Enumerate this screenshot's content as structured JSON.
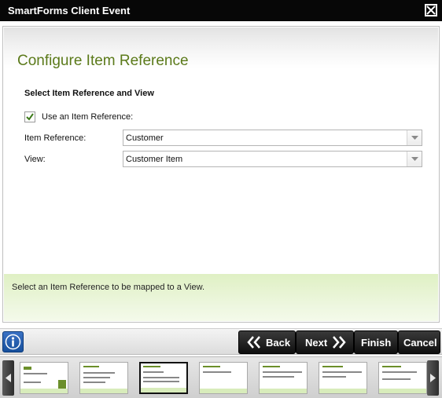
{
  "window": {
    "title": "SmartForms Client Event"
  },
  "header": {
    "title": "Configure Item Reference"
  },
  "section": {
    "title": "Select Item Reference and View"
  },
  "use_item_reference": {
    "label": "Use an Item Reference:",
    "checked": true
  },
  "fields": {
    "item_reference": {
      "label": "Item Reference:",
      "value": "Customer"
    },
    "view": {
      "label": "View:",
      "value": "Customer Item"
    }
  },
  "info": {
    "text": "Select an Item Reference to be mapped to a View."
  },
  "toolbar": {
    "back_label": "Back",
    "next_label": "Next",
    "finish_label": "Finish",
    "cancel_label": "Cancel"
  },
  "thumbnails": {
    "count": 7,
    "selected_index": 2
  },
  "colors": {
    "accent_green": "#5b7a1a",
    "info_bar": "#dff0c4",
    "info_button": "#1f5bb0"
  },
  "icons": [
    "close-icon",
    "checkmark-icon",
    "dropdown-arrow-icon",
    "info-icon",
    "back-chevron-icon",
    "next-chevron-icon",
    "scroll-left-icon",
    "scroll-right-icon"
  ]
}
